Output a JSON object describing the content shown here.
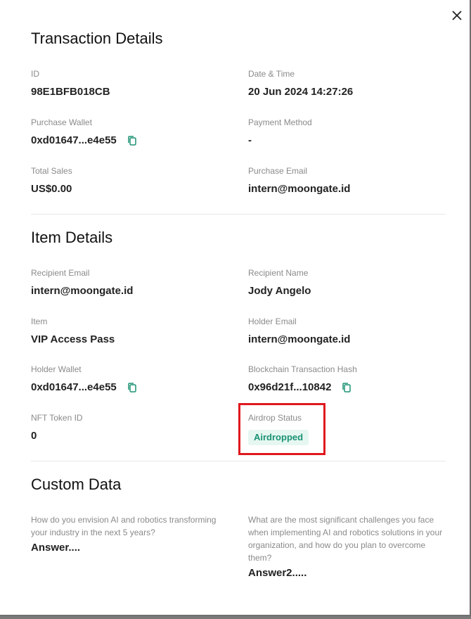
{
  "transaction": {
    "title": "Transaction Details",
    "id_label": "ID",
    "id_value": "98E1BFB018CB",
    "datetime_label": "Date & Time",
    "datetime_value": "20 Jun 2024 14:27:26",
    "wallet_label": "Purchase Wallet",
    "wallet_value": "0xd01647...e4e55",
    "payment_label": "Payment Method",
    "payment_value": "-",
    "sales_label": "Total Sales",
    "sales_value": "US$0.00",
    "email_label": "Purchase Email",
    "email_value": "intern@moongate.id"
  },
  "item": {
    "title": "Item Details",
    "recipient_email_label": "Recipient Email",
    "recipient_email_value": "intern@moongate.id",
    "recipient_name_label": "Recipient Name",
    "recipient_name_value": "Jody Angelo",
    "item_label": "Item",
    "item_value": "VIP Access Pass",
    "holder_email_label": "Holder Email",
    "holder_email_value": "intern@moongate.id",
    "holder_wallet_label": "Holder Wallet",
    "holder_wallet_value": "0xd01647...e4e55",
    "hash_label": "Blockchain Transaction Hash",
    "hash_value": "0x96d21f...10842",
    "token_label": "NFT Token ID",
    "token_value": "0",
    "airdrop_label": "Airdrop Status",
    "airdrop_value": "Airdropped"
  },
  "custom": {
    "title": "Custom Data",
    "q1": "How do you envision AI and robotics transforming your industry in the next 5 years?",
    "a1": "Answer....",
    "q2": "What are the most significant challenges you face when implementing AI and robotics solutions in your organization, and how do you plan to overcome them?",
    "a2": "Answer2....."
  },
  "colors": {
    "accent_green": "#1b9274",
    "badge_bg": "#e6f7f1",
    "highlight_red": "#e0181e"
  },
  "icons": {
    "close": "close-icon",
    "copy": "copy-icon"
  }
}
